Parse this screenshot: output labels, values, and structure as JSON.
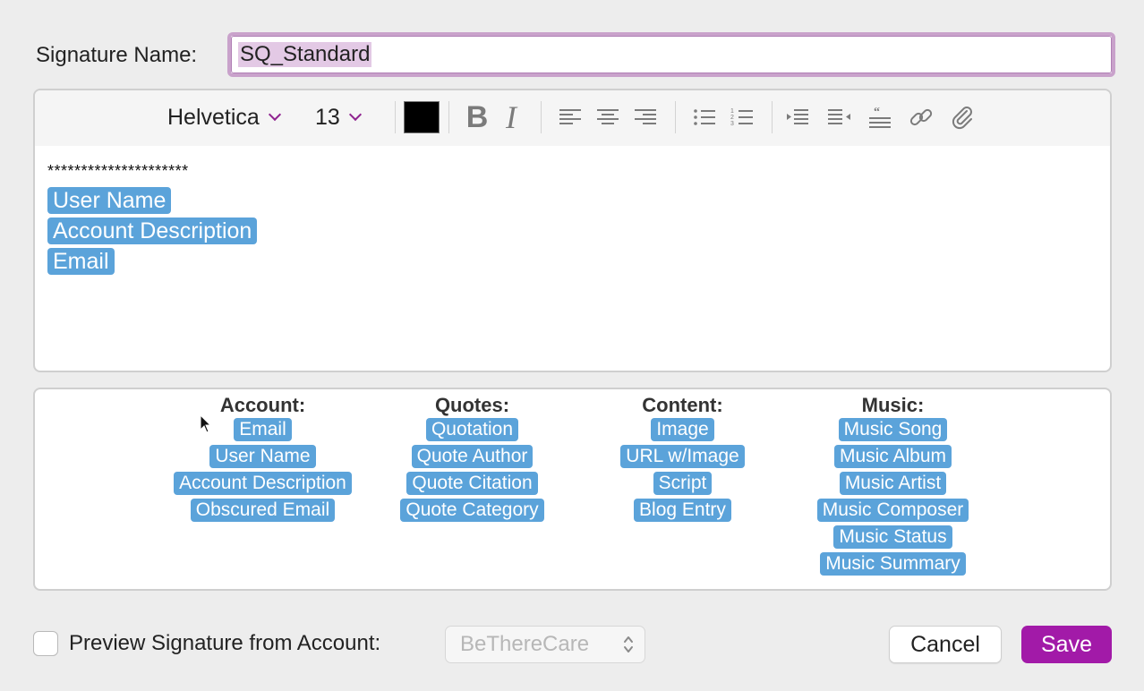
{
  "signature_name": {
    "label": "Signature Name:",
    "value": "SQ_Standard"
  },
  "toolbar": {
    "font": "Helvetica",
    "size": "13",
    "text_color": "#000000",
    "bold_label": "B",
    "italic_label": "I"
  },
  "editor": {
    "separator_line": "*********************",
    "tokens": [
      "User Name",
      "Account Description",
      "Email"
    ]
  },
  "palette": {
    "columns": [
      {
        "heading": "Account:",
        "tokens": [
          "Email",
          "User Name",
          "Account Description",
          "Obscured Email"
        ]
      },
      {
        "heading": "Quotes:",
        "tokens": [
          "Quotation",
          "Quote Author",
          "Quote Citation",
          "Quote Category"
        ]
      },
      {
        "heading": "Content:",
        "tokens": [
          "Image",
          "URL w/Image",
          "Script",
          "Blog Entry"
        ]
      },
      {
        "heading": "Music:",
        "tokens": [
          "Music Song",
          "Music Album",
          "Music Artist",
          "Music Composer",
          "Music Status",
          "Music Summary"
        ]
      }
    ]
  },
  "footer": {
    "preview_label": "Preview Signature from Account:",
    "account": "BeThereCare",
    "cancel_label": "Cancel",
    "save_label": "Save"
  },
  "colors": {
    "accent": "#a21aa8",
    "token_bg": "#5ba3da",
    "focus_ring": "#c9a2cb"
  },
  "icons": [
    "chevron-down-icon",
    "align-left-icon",
    "align-center-icon",
    "align-right-icon",
    "bullet-list-icon",
    "numbered-list-icon",
    "indent-decrease-icon",
    "indent-increase-icon",
    "block-quote-icon",
    "link-icon",
    "paperclip-icon",
    "mouse-pointer-icon",
    "up-down-chevron-icon"
  ]
}
